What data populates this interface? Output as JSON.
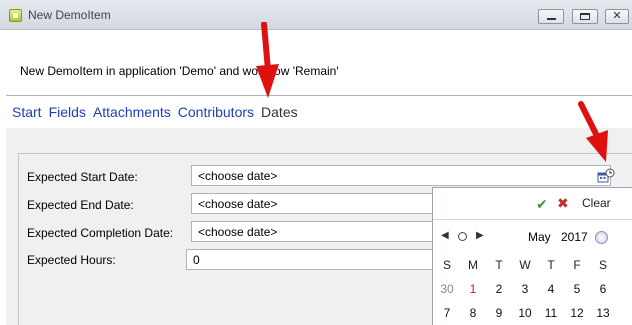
{
  "window": {
    "title": "New DemoItem",
    "icon": "app-icon",
    "controls": [
      "minimize-icon",
      "maximize-icon",
      "close-icon"
    ]
  },
  "header": {
    "message": "New DemoItem in application 'Demo' and workflow 'Remain'"
  },
  "tabs": [
    {
      "label": "Start",
      "active": false
    },
    {
      "label": "Fields",
      "active": false
    },
    {
      "label": "Attachments",
      "active": false
    },
    {
      "label": "Contributors",
      "active": false
    },
    {
      "label": "Dates",
      "active": true
    }
  ],
  "form": {
    "fields": [
      {
        "label": "Expected Start Date:",
        "value": "<choose date>"
      },
      {
        "label": "Expected End Date:",
        "value": "<choose date>"
      },
      {
        "label": "Expected Completion Date:",
        "value": "<choose date>"
      },
      {
        "label": "Expected Hours:",
        "value": "0"
      }
    ],
    "date_picker_icon": "calendar-clock-icon"
  },
  "calendar": {
    "ok_icon": "checkmark-icon",
    "cancel_icon": "x-icon",
    "clear_label": "Clear",
    "month": "May",
    "year": "2017",
    "weekday_headers": [
      "S",
      "M",
      "T",
      "W",
      "T",
      "F",
      "S"
    ],
    "weeks": [
      [
        {
          "d": "30",
          "other": true
        },
        {
          "d": "1",
          "today": true
        },
        {
          "d": "2"
        },
        {
          "d": "3"
        },
        {
          "d": "4"
        },
        {
          "d": "5"
        },
        {
          "d": "6"
        }
      ],
      [
        {
          "d": "7"
        },
        {
          "d": "8"
        },
        {
          "d": "9"
        },
        {
          "d": "10"
        },
        {
          "d": "11"
        },
        {
          "d": "12"
        },
        {
          "d": "13"
        }
      ]
    ],
    "colors": {
      "today": "#c32020",
      "ok": "#3a9a2a",
      "cancel": "#c0302a"
    }
  },
  "annotations": {
    "arrow_color": "#e01010"
  }
}
